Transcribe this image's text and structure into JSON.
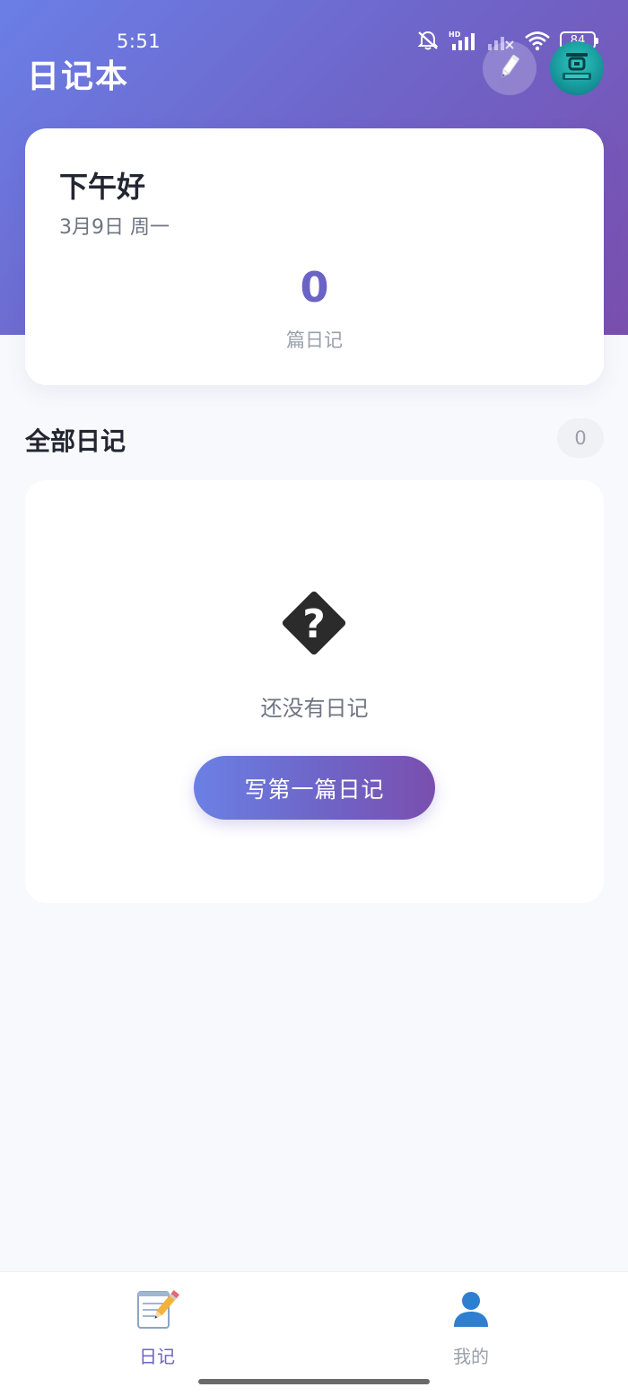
{
  "status_bar": {
    "time": "5:51",
    "battery": "84",
    "icons": [
      "mute-icon",
      "hd-signal-icon",
      "signal-off-icon",
      "wifi-icon",
      "battery-icon"
    ]
  },
  "header": {
    "title": "日记本",
    "edit_icon": "pencil-icon",
    "avatar_icon": "avatar-icon"
  },
  "summary": {
    "greeting": "下午好",
    "date": "3月9日 周一",
    "count": "0",
    "count_label": "篇日记"
  },
  "section": {
    "title": "全部日记",
    "count": "0"
  },
  "empty_state": {
    "icon": "question-diamond-icon",
    "text": "还没有日记",
    "button_label": "写第一篇日记"
  },
  "bottom_nav": {
    "items": [
      {
        "label": "日记",
        "icon": "memo-icon",
        "active": true
      },
      {
        "label": "我的",
        "icon": "user-icon",
        "active": false
      }
    ]
  },
  "colors": {
    "accent": "#6c63c6",
    "gradient_start": "#6a7fe6",
    "gradient_end": "#7a4fae"
  }
}
